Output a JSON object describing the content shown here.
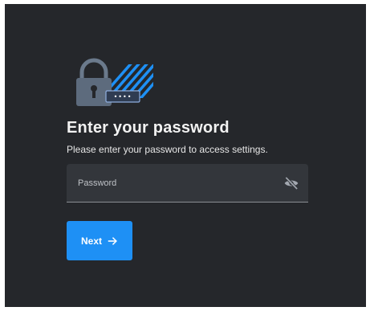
{
  "heading": {
    "title": "Enter your password",
    "subtitle": "Please enter your password to access settings."
  },
  "password_field": {
    "placeholder": "Password",
    "value": "",
    "visibility_icon": "eye-off-icon"
  },
  "next_button": {
    "label": "Next",
    "icon": "arrow-right-icon"
  },
  "illustration": {
    "icon": "padlock-icon",
    "dots": "••••"
  },
  "colors": {
    "background": "#25272b",
    "field": "#33363b",
    "accent": "#1e90f5",
    "lock_body": "#5d6b7d"
  }
}
